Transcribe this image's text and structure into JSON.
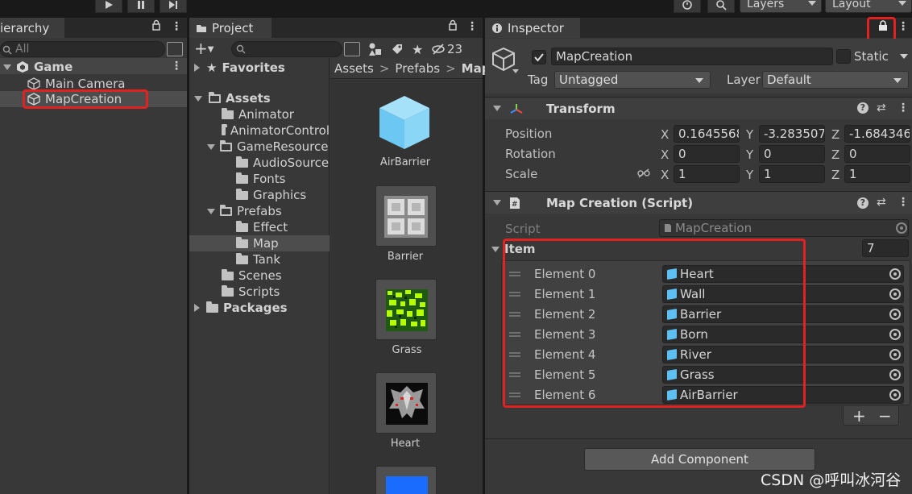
{
  "toolbar": {
    "layers": "Layers",
    "layout": "Layout"
  },
  "hierarchy": {
    "tab": "ierarchy",
    "search_placeholder": "All",
    "scene": "Game",
    "items": [
      "Main Camera",
      "MapCreation"
    ]
  },
  "project": {
    "tab": "Project",
    "hidden_count": "23",
    "breadcrumb": [
      "Assets",
      "Prefabs",
      "Map"
    ],
    "tree": {
      "favorites": "Favorites",
      "assets": "Assets",
      "animator": "Animator",
      "animatorcontrol": "AnimatorControl",
      "gameresource": "GameResource",
      "audiosource": "AudioSource",
      "fonts": "Fonts",
      "graphics": "Graphics",
      "prefabs": "Prefabs",
      "effect": "Effect",
      "map": "Map",
      "tank": "Tank",
      "scenes": "Scenes",
      "scripts": "Scripts",
      "packages": "Packages"
    },
    "assets": [
      "AirBarrier",
      "Barrier",
      "Grass",
      "Heart"
    ]
  },
  "inspector": {
    "tab": "Inspector",
    "object_name": "MapCreation",
    "static_label": "Static",
    "tag_label": "Tag",
    "tag_value": "Untagged",
    "layer_label": "Layer",
    "layer_value": "Default",
    "transform": {
      "title": "Transform",
      "position_label": "Position",
      "rotation_label": "Rotation",
      "scale_label": "Scale",
      "position": [
        "0.1645568",
        "-3.283507",
        "-1.684346"
      ],
      "rotation": [
        "0",
        "0",
        "0"
      ],
      "scale": [
        "1",
        "1",
        "1"
      ],
      "axis": [
        "X",
        "Y",
        "Z"
      ]
    },
    "script_component": {
      "title": "Map Creation (Script)",
      "script_label": "Script",
      "script_value": "MapCreation",
      "item_label": "Item",
      "item_count": "7",
      "elements": [
        {
          "label": "Element 0",
          "value": "Heart"
        },
        {
          "label": "Element 1",
          "value": "Wall"
        },
        {
          "label": "Element 2",
          "value": "Barrier"
        },
        {
          "label": "Element 3",
          "value": "Born"
        },
        {
          "label": "Element 4",
          "value": "River"
        },
        {
          "label": "Element 5",
          "value": "Grass"
        },
        {
          "label": "Element 6",
          "value": "AirBarrier"
        }
      ],
      "plus": "+",
      "minus": "−"
    },
    "add_component": "Add Component"
  },
  "watermark": "CSDN @呼叫冰河谷",
  "colors": {
    "highlight": "#e02222",
    "cube": "#5ec0f2",
    "panel": "#383838"
  }
}
